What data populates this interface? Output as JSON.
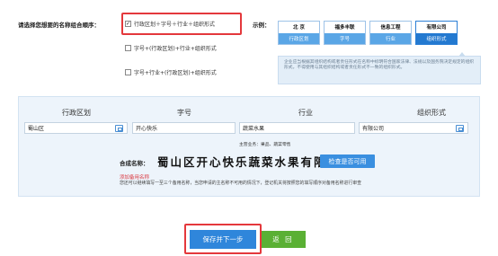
{
  "question": {
    "label": "请选择您想要的名称组合顺序："
  },
  "options": [
    {
      "label": "行政区划＋字号＋行业＋组织形式",
      "checked": true,
      "check_mark": "✓"
    },
    {
      "label": "字号+(行政区划)+行业+组织形式",
      "checked": false,
      "check_mark": ""
    },
    {
      "label": "字号+行业+(行政区划)+组织形式",
      "checked": false,
      "check_mark": ""
    }
  ],
  "example": {
    "label": "示例：",
    "cards": [
      {
        "title": "北  京",
        "caption": "行政区划"
      },
      {
        "title": "福多丰联",
        "caption": "字号"
      },
      {
        "title": "信息工程",
        "caption": "行业"
      },
      {
        "title": "有限公司",
        "caption": "组织形式"
      }
    ],
    "note": "企业应当根据其组织结构或者责任形式在名称中标明符合国家法律、法规以及国务院决定规定的组织形式，不得使用与其组织结构或者责任形式不一致的组织形式。"
  },
  "form": {
    "headers": {
      "region": "行政区划",
      "brand": "字号",
      "industry": "行业",
      "org": "组织形式"
    },
    "values": {
      "region": "蜀山区",
      "brand": "开心快乐",
      "industry": "蔬菜水果",
      "org": "有限公司"
    },
    "business_scope": "主营业务：果品、蔬菜零售",
    "combo_label": "合成名称：",
    "combo_name": "蜀山区开心快乐蔬菜水果有限公司",
    "check_button": "检查是否可用",
    "add_alt_link": "添加备用名称",
    "alt_note": "您还可以继续填写一至三个备用名称，当您申请的主名称不可用的情况下，登记机关将按照您的填写顺序对备用名称进行审查"
  },
  "actions": {
    "save_next": "保存并下一步",
    "back": "返 回"
  },
  "colors": {
    "accent_blue": "#2f86db",
    "back_green": "#5ab034",
    "highlight_red": "#e4383c",
    "panel_bg": "#edf4fb",
    "link_red": "#d9363e"
  }
}
